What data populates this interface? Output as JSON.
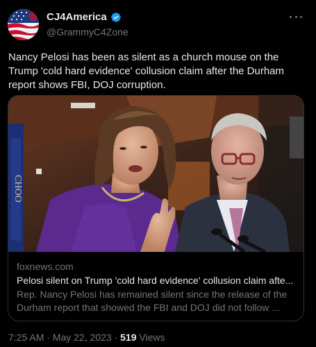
{
  "author": {
    "display_name": "CJ4America",
    "handle": "@GrammyC4Zone",
    "verified": true
  },
  "tweet": {
    "text": "Nancy Pelosi has been as silent as a church mouse on the Trump 'cold hard evidence' collusion claim after the Durham report shows FBI, DOJ corruption."
  },
  "card": {
    "domain": "foxnews.com",
    "title": "Pelosi silent on Trump 'cold hard evidence' collusion claim afte...",
    "description": "Rep. Nancy Pelosi has remained silent since the release of the Durham report that showed the FBI and DOJ did not follow ..."
  },
  "footer": {
    "time": "7:25 AM",
    "separator": "·",
    "date": "May 22, 2023",
    "views_count": "519",
    "views_label": "Views"
  },
  "colors": {
    "background": "#000000",
    "text_primary": "#e7e9ea",
    "text_secondary": "#71767b",
    "verified_blue": "#1d9bf0",
    "border": "#2f3336"
  },
  "icons": {
    "verified": "verified-badge-icon",
    "more": "more-options-icon"
  }
}
